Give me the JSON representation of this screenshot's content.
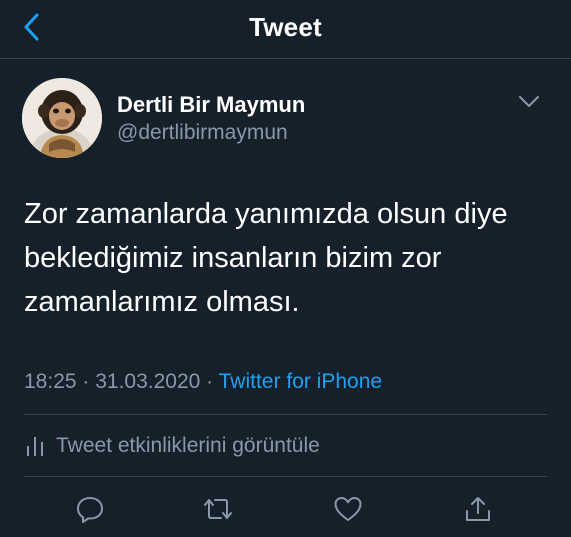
{
  "header": {
    "title": "Tweet",
    "back_icon": "chevron-left-icon"
  },
  "author": {
    "display_name": "Dertli Bir Maymun",
    "username": "@dertlibirmaymun",
    "avatar": "monkey-avatar",
    "menu_icon": "chevron-down-icon"
  },
  "tweet": {
    "text": "Zor zamanlarda yanımızda olsun diye\nbeklediğimiz insanların bizim zor\nzamanlarımız olması."
  },
  "meta": {
    "time": "18:25",
    "separator1": " · ",
    "date": "31.03.2020",
    "separator2": " · ",
    "source": "Twitter for iPhone"
  },
  "analytics": {
    "label": "Tweet etkinliklerini görüntüle",
    "icon": "analytics-bars-icon"
  },
  "actions": [
    {
      "name": "reply",
      "icon": "reply-icon"
    },
    {
      "name": "retweet",
      "icon": "retweet-icon"
    },
    {
      "name": "like",
      "icon": "heart-icon"
    },
    {
      "name": "share",
      "icon": "share-icon"
    }
  ],
  "colors": {
    "background": "#15202b",
    "divider": "#38444d",
    "secondary_text": "#8899a6",
    "accent": "#1da1f2",
    "primary_text": "#ffffff"
  }
}
